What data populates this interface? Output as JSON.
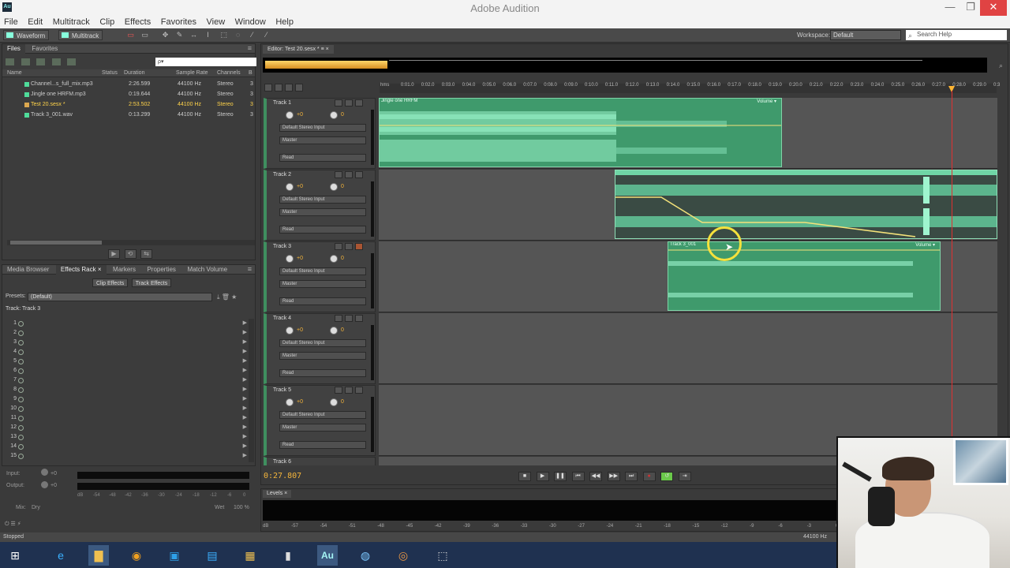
{
  "window": {
    "app_icon": "Au",
    "title": "Adobe Audition",
    "controls": [
      "—",
      "❐",
      "✕"
    ]
  },
  "menu": [
    "File",
    "Edit",
    "Multitrack",
    "Clip",
    "Effects",
    "Favorites",
    "View",
    "Window",
    "Help"
  ],
  "toolbar": {
    "waveform_label": "Waveform",
    "multitrack_label": "Multitrack",
    "workspace_label": "Workspace:",
    "workspace_value": "Default",
    "search_placeholder": "Search Help"
  },
  "files_panel": {
    "tabs": [
      "Files",
      "Favorites"
    ],
    "search_placeholder": "ρ▾",
    "columns": [
      "Name",
      "Status",
      "Duration",
      "Sample Rate",
      "Channels",
      "B"
    ],
    "rows": [
      {
        "name": "Channel...s_full_mix.mp3",
        "duration": "2:26.599",
        "rate": "44100 Hz",
        "channels": "Stereo",
        "b": "3"
      },
      {
        "name": "Jingle one HRFM.mp3",
        "duration": "0:19.644",
        "rate": "44100 Hz",
        "channels": "Stereo",
        "b": "3"
      },
      {
        "name": "Test 20.sesx *",
        "duration": "2:53.502",
        "rate": "44100 Hz",
        "channels": "Stereo",
        "b": "3"
      },
      {
        "name": "Track 3_001.wav",
        "duration": "0:13.299",
        "rate": "44100 Hz",
        "channels": "Stereo",
        "b": "3"
      }
    ]
  },
  "effects_panel": {
    "tabs": [
      "Media Browser",
      "Effects Rack ×",
      "Markers",
      "Properties",
      "Match Volume"
    ],
    "subtabs": [
      "Clip Effects",
      "Track Effects"
    ],
    "presets_label": "Presets:",
    "presets_value": "(Default)",
    "track_label": "Track: Track 3",
    "rack_slots": [
      "1",
      "2",
      "3",
      "4",
      "5",
      "6",
      "7",
      "8",
      "9",
      "10",
      "11",
      "12",
      "13",
      "14",
      "15"
    ]
  },
  "io": {
    "input_label": "Input:",
    "output_label": "Output:",
    "input_val": "+0",
    "output_val": "+0",
    "mix_label": "Mix:",
    "dry_label": "Dry",
    "wet_label": "Wet",
    "wet_val": "100 %",
    "scale": [
      "dB",
      "-54",
      "-48",
      "-42",
      "-36",
      "-30",
      "-24",
      "-18",
      "-12",
      "-6",
      "0"
    ]
  },
  "editor": {
    "tab": "Editor: Test 20.sesx * ≡ ×",
    "ruler": [
      "hms",
      "0:01.0",
      "0:02.0",
      "0:03.0",
      "0:04.0",
      "0:05.0",
      "0:06.0",
      "0:07.0",
      "0:08.0",
      "0:09.0",
      "0:10.0",
      "0:11.0",
      "0:12.0",
      "0:13.0",
      "0:14.0",
      "0:15.0",
      "0:16.0",
      "0:17.0",
      "0:18.0",
      "0:19.0",
      "0:20.0",
      "0:21.0",
      "0:22.0",
      "0:23.0",
      "0:24.0",
      "0:25.0",
      "0:26.0",
      "0:27.0",
      "0:28.0",
      "0:29.0",
      "0:3"
    ],
    "tracks": [
      {
        "name": "Track 1",
        "vol": "+0",
        "pan": "0",
        "input": "Default Stereo Input",
        "output": "Master",
        "mode": "Read"
      },
      {
        "name": "Track 2",
        "vol": "+0",
        "pan": "0",
        "input": "Default Stereo Input",
        "output": "Master",
        "mode": "Read"
      },
      {
        "name": "Track 3",
        "vol": "+0",
        "pan": "0",
        "input": "Default Stereo Input",
        "output": "Master",
        "mode": "Read"
      },
      {
        "name": "Track 4",
        "vol": "+0",
        "pan": "0",
        "input": "Default Stereo Input",
        "output": "Master",
        "mode": "Read"
      },
      {
        "name": "Track 5",
        "vol": "+0",
        "pan": "0",
        "input": "Default Stereo Input",
        "output": "Master",
        "mode": "Read"
      },
      {
        "name": "Track 6",
        "vol": "",
        "pan": "",
        "input": "",
        "output": "",
        "mode": ""
      }
    ],
    "clips": {
      "jingle_title": "Jingle one HRFM",
      "jingle_vol": "Volume ▾",
      "track3_title": "Track 3_001",
      "track3_vol": "Volume ▾"
    }
  },
  "transport": {
    "timecode": "0:27.807",
    "buttons": [
      "■",
      "▶",
      "❚❚",
      "⏮",
      "◀◀",
      "▶▶",
      "⏭",
      "●",
      "↺",
      "⇥"
    ]
  },
  "levels": {
    "tab": "Levels ×",
    "scale": [
      "dB",
      "-57",
      "-54",
      "-51",
      "-48",
      "-45",
      "-42",
      "-39",
      "-36",
      "-33",
      "-30",
      "-27",
      "-24",
      "-21",
      "-18",
      "-15",
      "-12",
      "-9",
      "-6",
      "-3",
      "0"
    ]
  },
  "status": {
    "left": "Stopped",
    "right": "44100 Hz"
  },
  "colors": {
    "clip_green": "#3f9a6c",
    "playhead": "#e03030",
    "timecode": "#f4b43a"
  }
}
